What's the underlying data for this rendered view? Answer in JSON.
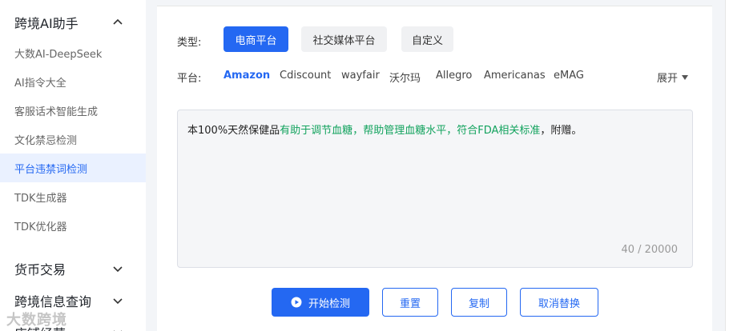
{
  "sidebar": {
    "group1": {
      "title": "跨境AI助手",
      "expanded": true
    },
    "items": [
      {
        "label": "大数AI-DeepSeek",
        "active": false
      },
      {
        "label": "AI指令大全",
        "active": false
      },
      {
        "label": "客服话术智能生成",
        "active": false
      },
      {
        "label": "文化禁忌检测",
        "active": false
      },
      {
        "label": "平台违禁词检测",
        "active": true
      },
      {
        "label": "TDK生成器",
        "active": false
      },
      {
        "label": "TDK优化器",
        "active": false
      }
    ],
    "group2": {
      "title": "货币交易",
      "expanded": false
    },
    "group3": {
      "title": "跨境信息查询",
      "expanded": false
    },
    "group4": {
      "title": "店铺经营",
      "expanded": false
    }
  },
  "form": {
    "type_label": "类型:",
    "types": [
      "电商平台",
      "社交媒体平台",
      "自定义"
    ],
    "platform_label": "平台:",
    "platforms": [
      "Amazon",
      "Cdiscount",
      "wayfair",
      "沃尔玛",
      "Allegro",
      "Americanas",
      "eMAG"
    ],
    "expand_label": "展开",
    "text_parts": [
      "本100%天然保健品",
      "有助于调节血糖",
      "，",
      "帮助管理血糖水平",
      "，",
      "符合FDA相关标准",
      "，附赠。"
    ],
    "counter": "40 / 20000"
  },
  "actions": {
    "start": "开始检测",
    "reset": "重置",
    "copy": "复制",
    "cancel_replace": "取消替换"
  },
  "watermark": "大数跨境",
  "colors": {
    "accent": "#2468f2",
    "highlight": "#13a35e"
  }
}
